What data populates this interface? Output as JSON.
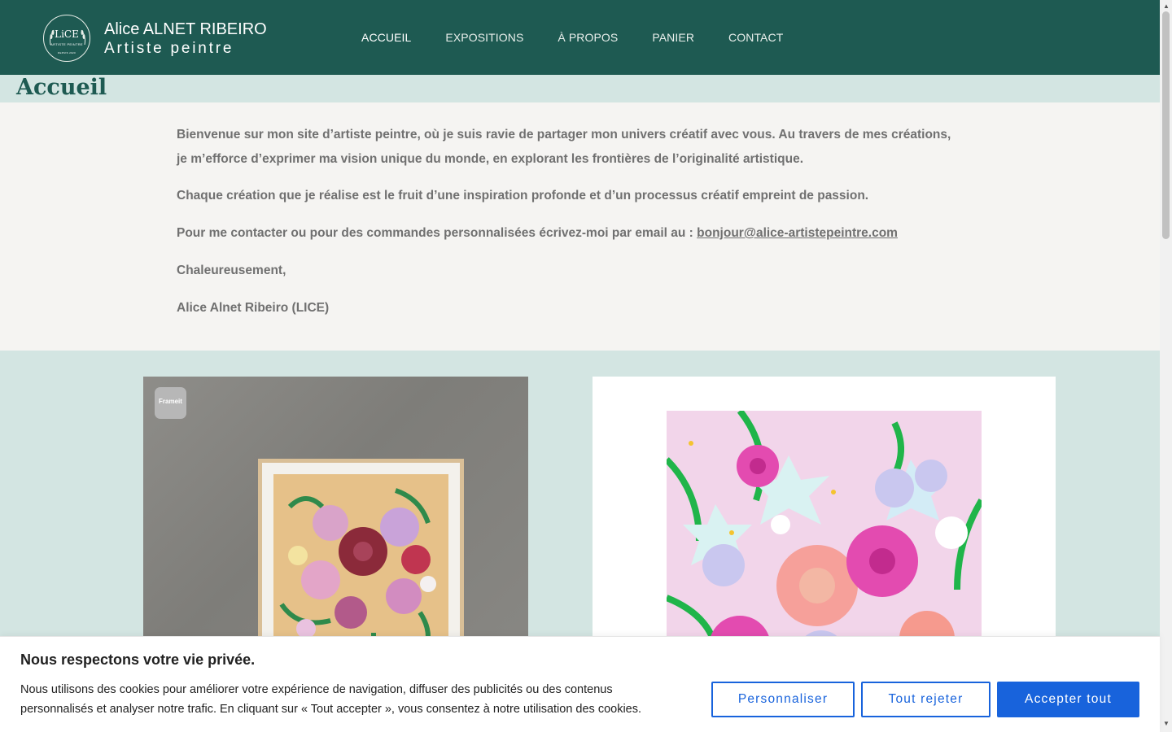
{
  "header": {
    "logo": {
      "main": "LiCE",
      "sub": "ARTISTE PEINTRE",
      "since": "DEPUIS 2020"
    },
    "brand_name": "Alice ALNET RIBEIRO",
    "brand_tagline": "Artiste peintre",
    "nav": [
      "ACCUEIL",
      "EXPOSITIONS",
      "À PROPOS",
      "PANIER",
      "CONTACT"
    ],
    "active_nav": "ACCUEIL",
    "background_color": "#1e5a52"
  },
  "page": {
    "title": "Accueil",
    "intro": {
      "p1": "Bienvenue sur mon site d’artiste peintre, où je suis ravie de partager mon univers créatif avec vous. Au travers de mes créations, je m’efforce d’exprimer ma vision unique du monde, en explorant les frontières de l’originalité artistique.",
      "p2": "Chaque création que je réalise est le fruit d’une inspiration profonde et d’un processus créatif empreint de passion.",
      "p3_prefix": "Pour me contacter ou pour des commandes personnalisées écrivez-moi par email au : ",
      "email": "bonjour@alice-artistepeintre.com",
      "p4": "Chaleureusement,",
      "p5": "Alice Alnet Ribeiro (LICE)"
    }
  },
  "gallery": {
    "badge_label": "Frameit"
  },
  "cookie_banner": {
    "title": "Nous respectons votre vie privée.",
    "text": "Nous utilisons des cookies pour améliorer votre expérience de navigation, diffuser des publicités ou des contenus personnalisés et analyser notre trafic. En cliquant sur « Tout accepter », vous consentez à notre utilisation des cookies.",
    "customize_label": "Personnaliser",
    "reject_label": "Tout rejeter",
    "accept_label": "Accepter tout",
    "accent_color": "#1863dc"
  }
}
